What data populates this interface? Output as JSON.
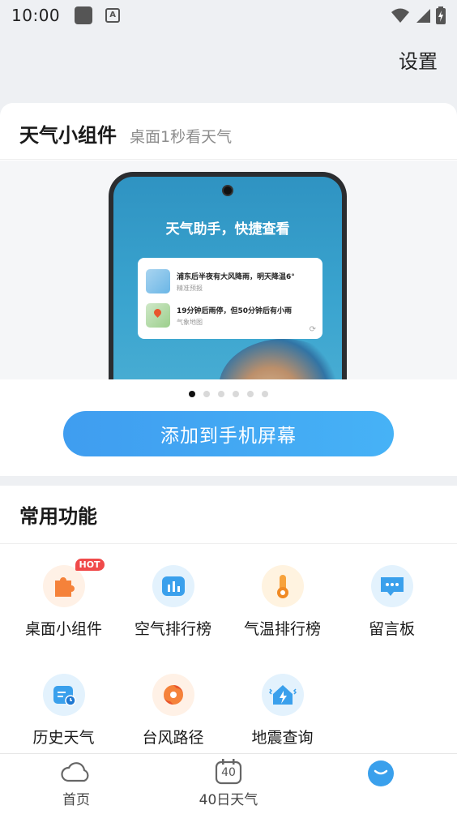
{
  "status_bar": {
    "time": "10:00",
    "a_icon_text": "A"
  },
  "header": {
    "settings_label": "设置"
  },
  "widget_card": {
    "title": "天气小组件",
    "subtitle": "桌面1秒看天气",
    "preview": {
      "headline": "天气助手，快捷查看",
      "notifications": [
        {
          "main": "浦东后半夜有大风降雨，明天降温6°",
          "sub": "精准预报"
        },
        {
          "main": "19分钟后雨停，但50分钟后有小雨",
          "sub": "气象地图"
        }
      ]
    },
    "carousel": {
      "count": 6,
      "active_index": 0
    },
    "add_button_label": "添加到手机屏幕"
  },
  "functions": {
    "title": "常用功能",
    "hot_badge": "HOT",
    "items": [
      {
        "label": "桌面小组件",
        "icon": "puzzle-icon"
      },
      {
        "label": "空气排行榜",
        "icon": "bar-chart-icon"
      },
      {
        "label": "气温排行榜",
        "icon": "thermometer-icon"
      },
      {
        "label": "留言板",
        "icon": "message-board-icon"
      },
      {
        "label": "历史天气",
        "icon": "history-calendar-icon"
      },
      {
        "label": "台风路径",
        "icon": "typhoon-icon"
      },
      {
        "label": "地震查询",
        "icon": "earthquake-icon"
      }
    ]
  },
  "bottom_nav": {
    "items": [
      {
        "label": "首页",
        "icon": "cloud-icon"
      },
      {
        "label": "40日天气",
        "icon": "calendar-40-icon",
        "badge": "40"
      },
      {
        "label": "",
        "icon": "profile-icon"
      }
    ]
  },
  "colors": {
    "accent": "#3f9df0",
    "hot": "#f04a4a",
    "page_bg": "#eef0f3"
  }
}
